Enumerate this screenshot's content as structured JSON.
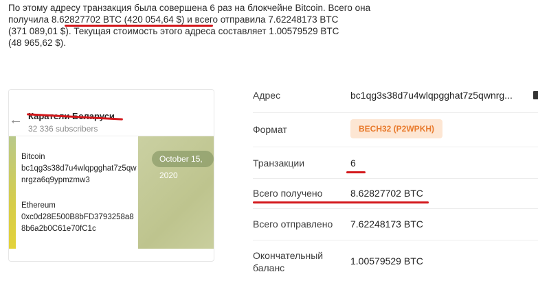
{
  "summary": {
    "line1": "По этому адресу транзакция была совершена 6 раз на блокчейне Bitcoin. Всего она",
    "line2_pre": "получила ",
    "line2_hl": "8.62827702 BTC (420 054,64 $)",
    "line2_post": " и всего отправила 7.62248173 BTC",
    "line3": "(371 089,01 $). Текущая стоимость этого адреса составляет 1.00579529 BTC",
    "line4": "(48 965,62 $)."
  },
  "telegram": {
    "channel_name": "Каратели Беларуси",
    "subscribers": "32 336 subscribers",
    "date_pill": "October 15, 2020",
    "msg": {
      "btc_label": "Bitcoin",
      "btc_address": "bc1qg3s38d7u4wlqpgghat7z5qwnrgza6q9ypmzmw3",
      "eth_label": "Ethereum",
      "eth_address": "0xc0d28E500B8bFD3793258a88b6a2b0C61e70fC1c"
    }
  },
  "info": {
    "address": {
      "key": "Адрес",
      "value": "bc1qg3s38d7u4wlqpgghat7z5qwnrg..."
    },
    "format": {
      "key": "Формат",
      "value": "BECH32 (P2WPKH)"
    },
    "transactions": {
      "key": "Транзакции",
      "value": "6"
    },
    "received": {
      "key": "Всего получено",
      "value": "8.62827702 BTC"
    },
    "sent": {
      "key": "Всего отправлено",
      "value": "7.62248173 BTC"
    },
    "balance": {
      "key_line1": "Окончательный",
      "key_line2": "баланс",
      "value": "1.00579529 BTC"
    }
  },
  "icons": {
    "back": "arrow-left-icon",
    "copy": "copy-icon"
  },
  "colors": {
    "annotation_red": "#d3171b",
    "badge_bg": "#fde6d3",
    "badge_text": "#e87a2c"
  }
}
